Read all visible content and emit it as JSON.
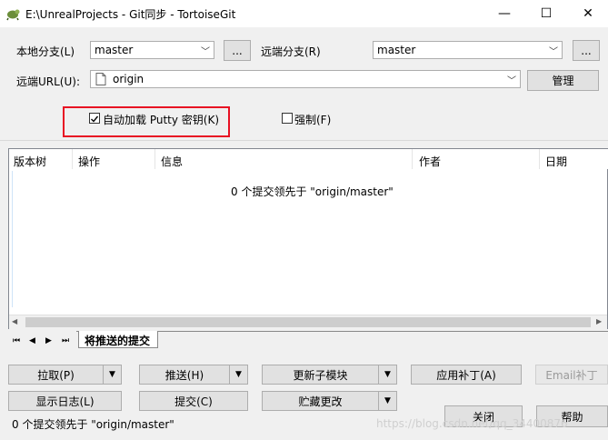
{
  "window": {
    "title": "E:\\UnrealProjects - Git同步 - TortoiseGit",
    "minimize_glyph": "—",
    "maximize_glyph": "☐",
    "close_glyph": "✕"
  },
  "form": {
    "local_branch_label": "本地分支(L)",
    "local_branch_value": "master",
    "remote_branch_label": "远端分支(R)",
    "remote_branch_value": "master",
    "remote_url_label": "远端URL(U):",
    "remote_url_value": "origin",
    "browse_label": "...",
    "manage_label": "管理",
    "putty_checkbox_label": "自动加载 Putty 密钥(K)",
    "putty_checked": true,
    "force_checkbox_label": "强制(F)",
    "force_checked": false
  },
  "table": {
    "columns": [
      "版本树",
      "操作",
      "信息",
      "作者",
      "日期"
    ],
    "empty_message": "0 个提交领先于 \"origin/master\""
  },
  "tabs": {
    "nav": [
      "⏮",
      "◀",
      "▶",
      "⏭"
    ],
    "active_tab": "将推送的提交"
  },
  "buttons": {
    "pull": "拉取(P)",
    "push": "推送(H)",
    "update_submodule": "更新子模块",
    "apply_patch": "应用补丁(A)",
    "email_patch": "Email补丁",
    "show_log": "显示日志(L)",
    "commit": "提交(C)",
    "stash": "贮藏更改",
    "close": "关闭",
    "help": "帮助"
  },
  "status": {
    "text": "0 个提交领先于 \"origin/master\""
  },
  "watermark": "https://blog.csdn.net/qq_34400876",
  "colors": {
    "highlight_border": "#e81123",
    "dialog_bg": "#f0f0f0"
  }
}
